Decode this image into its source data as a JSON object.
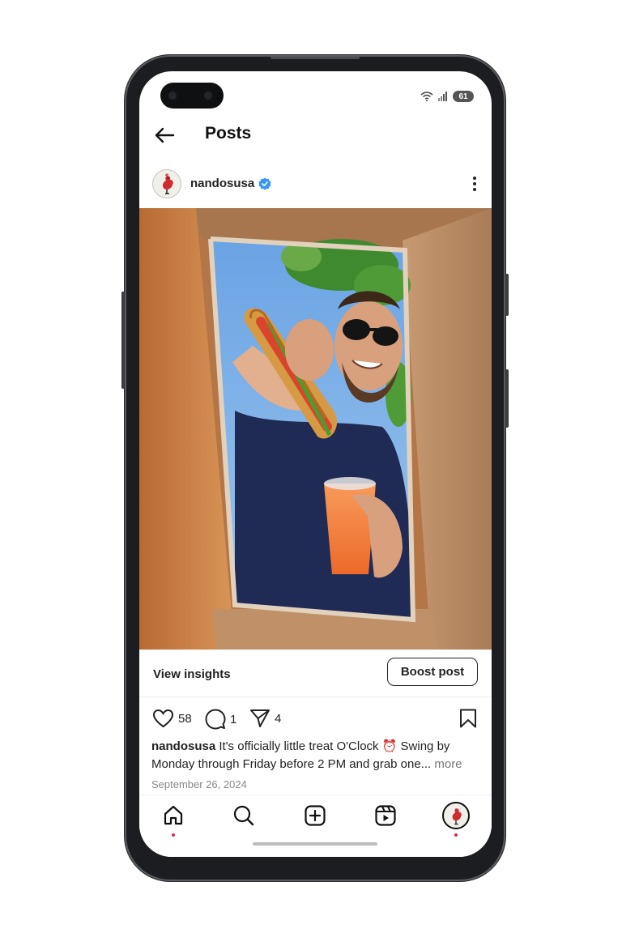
{
  "status_bar": {
    "battery": "61"
  },
  "top_bar": {
    "title": "Posts"
  },
  "post": {
    "username": "nandosusa",
    "view_insights_label": "View insights",
    "boost_label": "Boost post",
    "likes": "58",
    "comments": "1",
    "shares": "4",
    "caption_username": "nandosusa",
    "caption_text": "It's officially little treat O'Clock ⏰ Swing by Monday through Friday before 2 PM and grab one...",
    "caption_more": "more",
    "date": "September 26, 2024"
  },
  "colors": {
    "verified": "#3897f0",
    "notification_dot": "#e0284a",
    "brand_red": "#d12a2f"
  },
  "icons": {
    "back": "arrow-left-icon",
    "menu": "more-vertical-icon",
    "like": "heart-icon",
    "comment": "comment-icon",
    "share": "send-icon",
    "save": "bookmark-icon",
    "nav": [
      "home-icon",
      "search-icon",
      "create-icon",
      "reels-icon",
      "profile-avatar"
    ]
  }
}
